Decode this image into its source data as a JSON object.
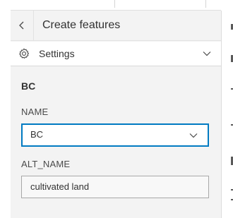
{
  "header": {
    "title": "Create features",
    "back_icon": "chevron-left-icon"
  },
  "settings": {
    "label": "Settings",
    "icon": "gear-icon",
    "expand_icon": "chevron-down-icon"
  },
  "feature": {
    "title": "BC"
  },
  "fields": {
    "name": {
      "label": "NAME",
      "value": "BC"
    },
    "alt_name": {
      "label": "ALT_NAME",
      "value": "cultivated land"
    }
  },
  "colors": {
    "accent": "#007ac2",
    "panel_bg": "#f3f3f3",
    "text": "#323232"
  }
}
